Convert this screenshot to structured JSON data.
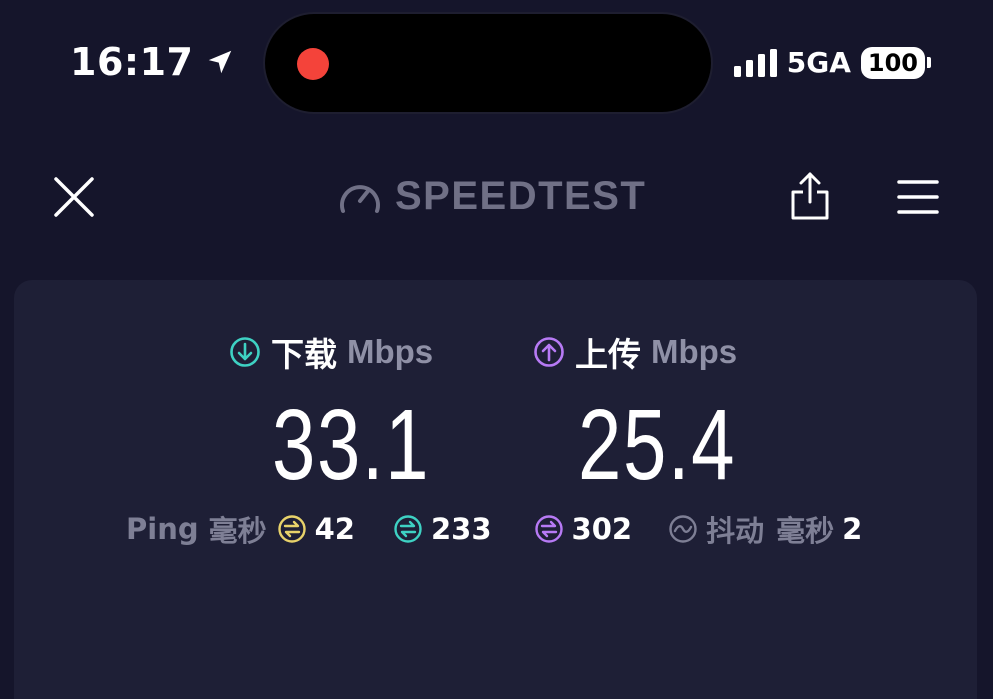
{
  "status_bar": {
    "time": "16:17",
    "network": "5GA",
    "battery": "100"
  },
  "header": {
    "brand": "SPEEDTEST"
  },
  "results": {
    "download": {
      "label": "下载",
      "unit": "Mbps",
      "value": "33.1"
    },
    "upload": {
      "label": "上传",
      "unit": "Mbps",
      "value": "25.4"
    },
    "ping": {
      "label": "Ping",
      "unit": "毫秒",
      "idle": "42",
      "download": "233",
      "upload": "302"
    },
    "jitter": {
      "label": "抖动",
      "unit": "毫秒",
      "value": "2"
    }
  },
  "colors": {
    "background": "#15152b",
    "card": "#1e1f36",
    "download_accent": "#3ed1c3",
    "upload_accent": "#b77af5",
    "idle_accent": "#e8d26a",
    "muted_text": "#7e7f95",
    "record_dot": "#f4433a"
  }
}
